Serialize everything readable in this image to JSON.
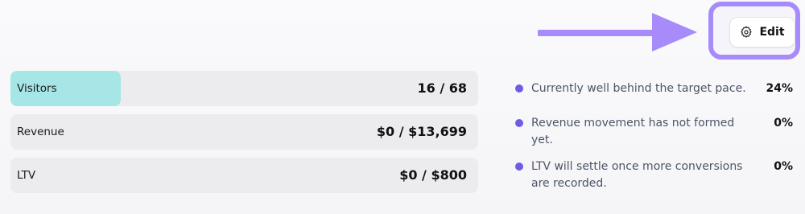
{
  "toolbar": {
    "edit_label": "Edit"
  },
  "icons": {
    "edit": "gear-icon",
    "annotation": "arrow-right-icon",
    "bullet": "dot-icon"
  },
  "colors": {
    "annotation": "#a78bfa",
    "progress_fill": "#a6e6e6",
    "bullet": "#6c5ce7",
    "row_background": "#ececee"
  },
  "metrics": [
    {
      "name": "Visitors",
      "value": "16 / 68",
      "progress": 0.235
    },
    {
      "name": "Revenue",
      "value": "$0 / $13,699",
      "progress": 0
    },
    {
      "name": "LTV",
      "value": "$0 / $800",
      "progress": 0
    }
  ],
  "insights": [
    {
      "text": "Currently well behind the target pace.",
      "percent": "24%"
    },
    {
      "text": "Revenue movement has not formed yet.",
      "percent": "0%"
    },
    {
      "text": "LTV will settle once more conversions are recorded.",
      "percent": "0%"
    }
  ]
}
